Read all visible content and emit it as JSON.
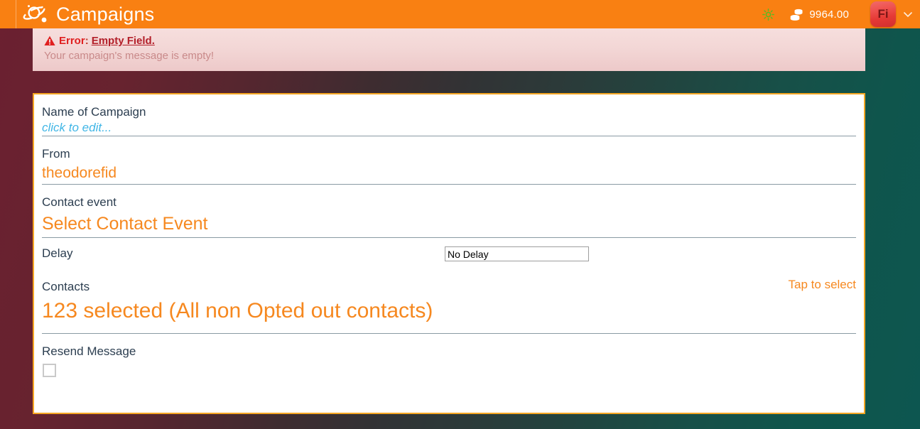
{
  "header": {
    "logo_name": "planet-logo",
    "title": "Campaigns",
    "brightness_icon": "sun-icon",
    "credits_icon": "coins-icon",
    "credits": "9964.00",
    "avatar_initials": "Fi",
    "chevron_icon": "chevron-down-icon",
    "bg_color": "#f98012"
  },
  "error_banner": {
    "icon": "warning-triangle-icon",
    "label": "Error",
    "separator": ":",
    "link": "Empty Field.",
    "message": "Your campaign's message is empty!",
    "accent_color": "#d0021b"
  },
  "form": {
    "name_field": {
      "label": "Name of Campaign",
      "value": "click to edit...",
      "is_placeholder": true
    },
    "from_field": {
      "label": "From",
      "value": "theodorefid"
    },
    "contact_event_field": {
      "label": "Contact event",
      "value": "Select Contact Event"
    },
    "delay_field": {
      "label": "Delay",
      "selected": "No Delay",
      "options": [
        "No Delay"
      ]
    },
    "contacts_field": {
      "label": "Contacts",
      "action": "Tap to select",
      "value": "123 selected (All non Opted out contacts)"
    },
    "resend_field": {
      "label": "Resend Message",
      "checked": false
    }
  },
  "theme": {
    "accent_orange": "#f6881f",
    "card_border": "#f5a623",
    "link_blue": "#41b6e6",
    "label_dark": "#2c3e50",
    "bg_left": "#6b2030",
    "bg_right": "#0d5650"
  }
}
